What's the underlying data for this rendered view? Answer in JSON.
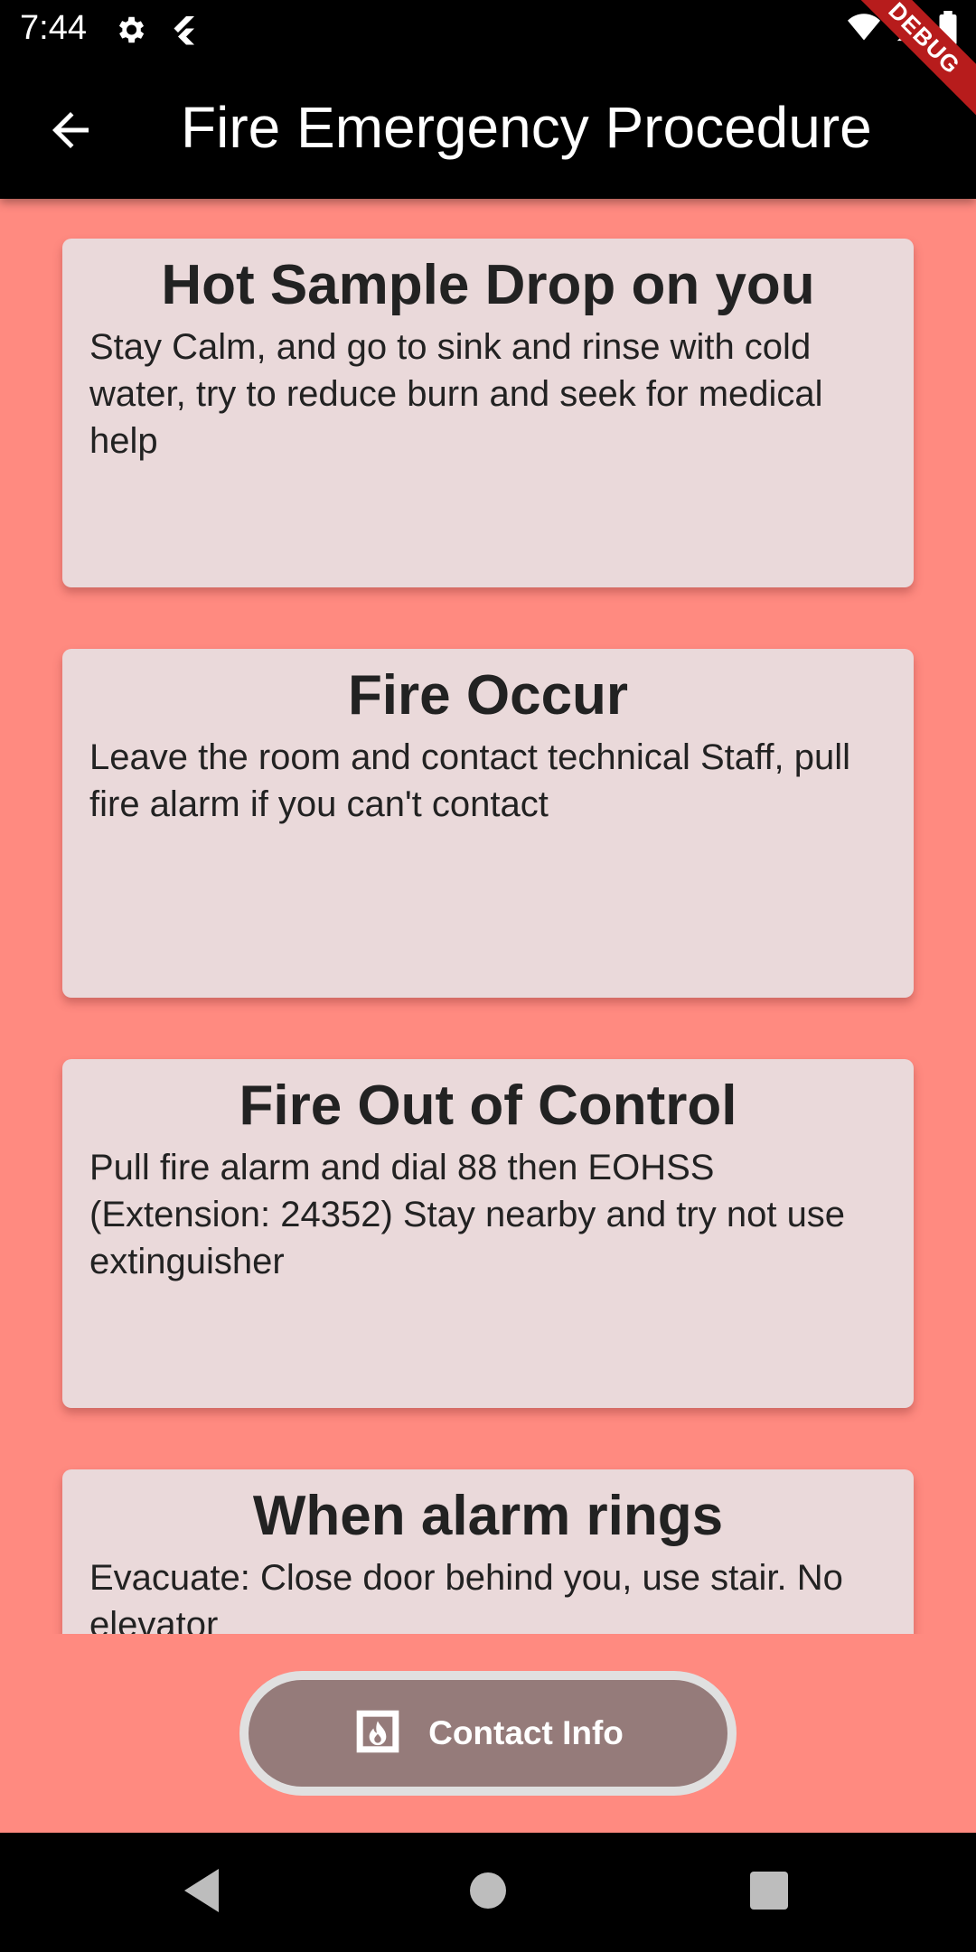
{
  "status_bar": {
    "time": "7:44",
    "left_icons": [
      "gear-icon",
      "flutter-icon"
    ],
    "right_icons": [
      "wifi-icon",
      "signal-icon",
      "battery-icon"
    ],
    "debug_label": "DEBUG"
  },
  "app_bar": {
    "back_icon": "arrow-back-icon",
    "title": "Fire Emergency Procedure"
  },
  "cards": [
    {
      "title": "Hot Sample Drop on you",
      "body": "Stay Calm, and go to sink and rinse with cold water, try to reduce burn and seek for medical help"
    },
    {
      "title": "Fire Occur",
      "body": "Leave the room and contact technical Staff, pull fire alarm if you can't contact"
    },
    {
      "title": "Fire Out of Control",
      "body": "Pull fire alarm and dial 88 then EOHSS (Extension: 24352) Stay nearby and try not use extinguisher"
    },
    {
      "title": "When alarm rings",
      "body": "Evacuate: Close door behind you, use stair. No elevator"
    }
  ],
  "contact_button": {
    "icon": "fireplace-icon",
    "label": "Contact Info"
  },
  "nav_bar": {
    "buttons": [
      "back-triangle-icon",
      "home-circle-icon",
      "recents-square-icon"
    ]
  },
  "colors": {
    "background": "#ff8a80",
    "card": "#ead9da",
    "button": "#957b7a",
    "app_bar": "#000000"
  }
}
